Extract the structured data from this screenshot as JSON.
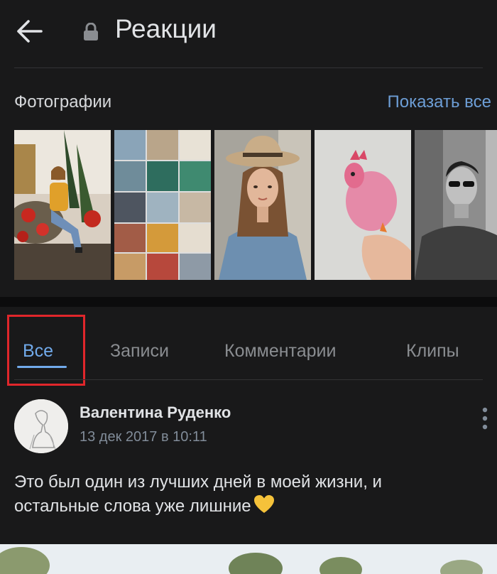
{
  "header": {
    "title": "Реакции",
    "back_icon": "arrow-left-icon",
    "lock_icon": "lock-icon"
  },
  "photos": {
    "title": "Фотографии",
    "show_all": "Показать все",
    "items": [
      {
        "name": "photo-woman-flowers"
      },
      {
        "name": "photo-collage"
      },
      {
        "name": "photo-woman-hat"
      },
      {
        "name": "photo-pink-toy"
      },
      {
        "name": "photo-man-sunglasses"
      }
    ]
  },
  "tabs": {
    "items": [
      "Все",
      "Записи",
      "Комментарии",
      "Клипы"
    ],
    "active": "Все"
  },
  "post": {
    "author": "Валентина Руденко",
    "date": "13 дек 2017 в 10:11",
    "text": "Это был один из лучших дней в моей жизни, и остальные слова уже лишние",
    "emoji_icon": "yellow-heart-icon"
  },
  "colors": {
    "background": "#19191a",
    "accent": "#71aaeb",
    "link": "#6d9ed6",
    "highlight": "#e0262b"
  }
}
